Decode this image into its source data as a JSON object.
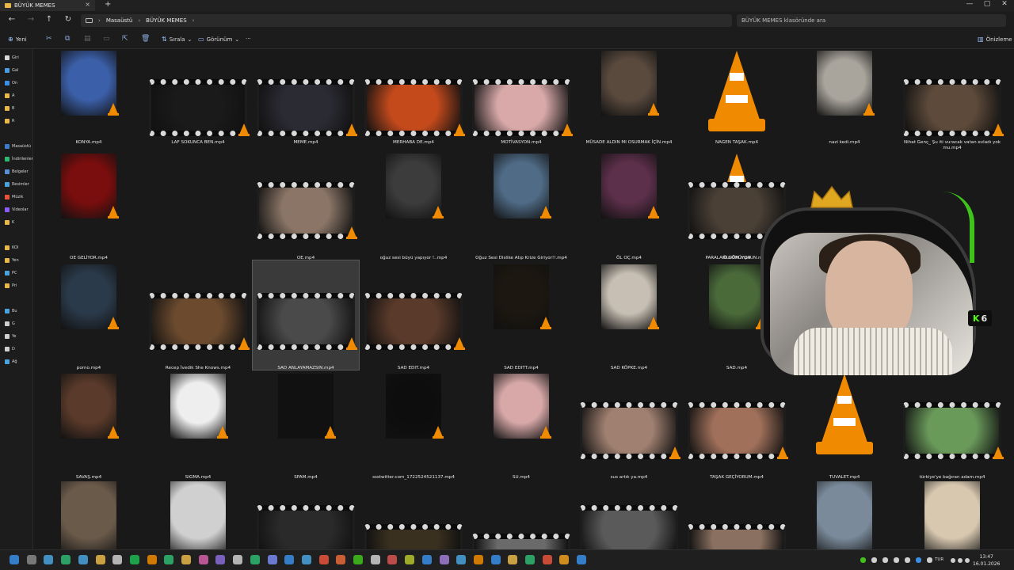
{
  "tab": {
    "title": "BÜYÜK MEMES",
    "close": "×",
    "new": "+"
  },
  "window": {
    "minimize": "—",
    "maximize": "▢",
    "close": "✕"
  },
  "nav": {
    "back": "←",
    "forward": "→",
    "up": "↑",
    "refresh": "↻"
  },
  "breadcrumb": {
    "first": "Masaüstü",
    "second": "BÜYÜK MEMES",
    "sep": "›"
  },
  "search": {
    "placeholder": "BÜYÜK MEMES klasöründe ara"
  },
  "commands": {
    "new": "Yeni",
    "sort": "Sırala",
    "view": "Görünüm",
    "more": "···",
    "preview": "Önizleme"
  },
  "sidebar": {
    "items": [
      {
        "label": "Giri",
        "color": "#d9d9d9"
      },
      {
        "label": "Gal",
        "color": "#4b9be0"
      },
      {
        "label": "On",
        "color": "#3a8ee6"
      },
      {
        "label": "A",
        "color": "#e8b84a"
      },
      {
        "label": "B",
        "color": "#e8b84a"
      },
      {
        "label": "R",
        "color": "#e8b84a"
      },
      {
        "label": "Masaüstü",
        "color": "#3d7cc9"
      },
      {
        "label": "İndirilenler",
        "color": "#2eb872"
      },
      {
        "label": "Belgeler",
        "color": "#5a8fd6"
      },
      {
        "label": "Resimler",
        "color": "#4aa3df"
      },
      {
        "label": "Müzik",
        "color": "#e8533a"
      },
      {
        "label": "Videolar",
        "color": "#8b5cf6"
      },
      {
        "label": "K",
        "color": "#e8b84a"
      },
      {
        "label": "KOI",
        "color": "#e8b84a"
      },
      {
        "label": "Yen",
        "color": "#e8b84a"
      },
      {
        "label": "PC",
        "color": "#4aa3df"
      },
      {
        "label": "Pri",
        "color": "#e8b84a"
      },
      {
        "label": "Bu",
        "color": "#4aa3df"
      },
      {
        "label": "G",
        "color": "#cfcfcf"
      },
      {
        "label": "Ye",
        "color": "#cfcfcf"
      },
      {
        "label": "D",
        "color": "#cfcfcf"
      },
      {
        "label": "Ağ",
        "color": "#4aa3df"
      }
    ]
  },
  "files": [
    {
      "name": "KONYA.mp4",
      "kind": "plain",
      "color": "#3b5fa8"
    },
    {
      "name": "LAF SOKUNCA BEN.mp4",
      "kind": "strip",
      "color": "#1a1a1a"
    },
    {
      "name": "MEME.mp4",
      "kind": "strip",
      "color": "#2b2b34"
    },
    {
      "name": "MERHABA DE.mp4",
      "kind": "strip",
      "color": "#c44a1c"
    },
    {
      "name": "MOTİVASYON.mp4",
      "kind": "strip",
      "color": "#d9a9a9"
    },
    {
      "name": "MÜSADE ALDIN MI OSURMAK İÇİN.mp4",
      "kind": "plain",
      "color": "#5a4a3e"
    },
    {
      "name": "NAGEN TAŞAK.mp4",
      "kind": "cone",
      "color": "#191919"
    },
    {
      "name": "nazi kedi.mp4",
      "kind": "plain",
      "color": "#a9a49c"
    },
    {
      "name": "Nihat Genç_ Şu iti vuracak vatan evladı yok mu.mp4",
      "kind": "strip",
      "color": "#5d4a3a"
    },
    {
      "name": "OE GELİYOR.mp4",
      "kind": "plain",
      "color": "#7a0d0d"
    },
    {
      "name": "OE.mp4",
      "kind": "strip",
      "color": "#8a7566"
    },
    {
      "name": "oğuz sesi büyü yapıyor !..mp4",
      "kind": "plain",
      "color": "#3c3c3c"
    },
    {
      "name": "Oğuz Sesi Dislike Atıp Krize Giriyor!!.mp4",
      "kind": "plain",
      "color": "#4f6b86"
    },
    {
      "name": "ÖL OÇ.mp4",
      "kind": "plain",
      "color": "#5c2f4a"
    },
    {
      "name": "ÖLDÜM.mp4",
      "kind": "cone",
      "color": "#191919"
    },
    {
      "name": "PARALARI GÖRÜYOSUN.mp4",
      "kind": "strip",
      "color": "#4a4036"
    },
    {
      "name": "porno.mp4",
      "kind": "plain",
      "color": "#2b3a4a"
    },
    {
      "name": "Recep İvedik She Knows.mp4",
      "kind": "strip",
      "color": "#6b4a2e"
    },
    {
      "name": "SAD ANLAYAMAZSIN.mp4",
      "kind": "strip",
      "color": "#4a4a4a"
    },
    {
      "name": "SAD EDIT.mp4",
      "kind": "strip",
      "color": "#5a3a2a"
    },
    {
      "name": "SAD EDITT.mp4",
      "kind": "plain",
      "color": "#1c1710"
    },
    {
      "name": "SAD KÖPKE.mp4",
      "kind": "plain",
      "color": "#c7bfb3"
    },
    {
      "name": "SAD.mp4",
      "kind": "plain",
      "color": "#4a6a3a"
    },
    {
      "name": "SAVAŞ.mp4",
      "kind": "plain",
      "color": "#5a3a2a"
    },
    {
      "name": "SIGMA.mp4",
      "kind": "plain",
      "color": "#eeeeee"
    },
    {
      "name": "SPAM.mp4",
      "kind": "plain",
      "color": "#111111"
    },
    {
      "name": "ssstwitter.com_1722524521137.mp4",
      "kind": "plain",
      "color": "#0d0d0d"
    },
    {
      "name": "SU.mp4",
      "kind": "plain",
      "color": "#d8a8a8"
    },
    {
      "name": "sus artık ya.mp4",
      "kind": "strip",
      "color": "#a08070"
    },
    {
      "name": "TAŞAK GEÇİYORUM.mp4",
      "kind": "strip",
      "color": "#a0705a"
    },
    {
      "name": "TUVALET.mp4",
      "kind": "cone",
      "color": "#191919"
    },
    {
      "name": "türkiye'ye bağıran adam.mp4",
      "kind": "strip",
      "color": "#6a9a5a"
    }
  ],
  "partial_row_colors": [
    "#6a5a4a",
    "#d0d0d0",
    "#2a2a2a",
    "#3a3020",
    "#6a6a6a",
    "#5a5a5a",
    "#8a7060",
    "#7a8a9a",
    "#d8c8b0"
  ],
  "overlay": {
    "badge_k": "K",
    "badge_num": "6"
  },
  "taskbar": {
    "lang": "TUR",
    "time": "13:47",
    "date": "16.01.2026"
  },
  "colors": {
    "vlc_orange": "#f08a00",
    "accent_blue": "#3a8ee6",
    "kick_green": "#53fc18"
  }
}
